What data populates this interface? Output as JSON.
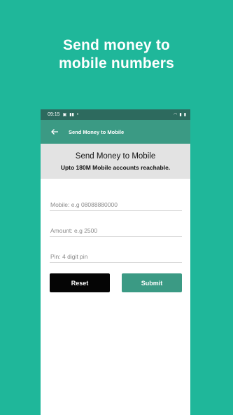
{
  "headline": {
    "line1": "Send money to",
    "line2": "mobile numbers"
  },
  "status_bar": {
    "time": "09:15",
    "left_icons": [
      "image-icon",
      "signal-icon",
      "dot-icon"
    ],
    "right_icons": [
      "wifi-icon",
      "signal-icon",
      "battery-icon"
    ]
  },
  "app_bar": {
    "title": "Send Money to Mobile",
    "back_icon": "arrow-left-icon"
  },
  "banner": {
    "title": "Send Money to Mobile",
    "subtitle": "Upto 180M Mobile accounts reachable."
  },
  "form": {
    "mobile_placeholder": "Mobile: e.g 08088880000",
    "amount_placeholder": "Amount: e.g 2500",
    "pin_placeholder": "Pin: 4 digit pin"
  },
  "buttons": {
    "reset": "Reset",
    "submit": "Submit"
  },
  "colors": {
    "background": "#1fb79a",
    "app_bar": "#3b9a84",
    "status_bar": "#2d6a5e",
    "reset_button": "#050505",
    "submit_button": "#3b9a84"
  }
}
